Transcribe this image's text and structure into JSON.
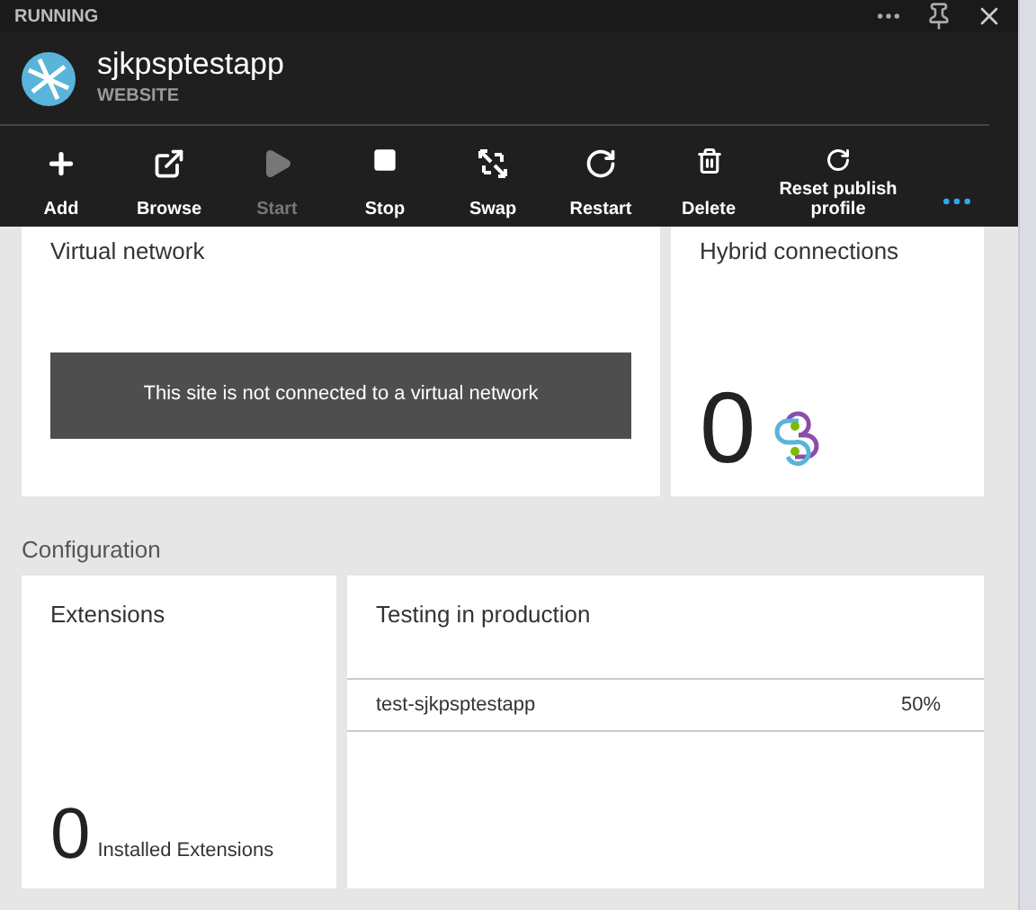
{
  "status": "RUNNING",
  "resource": {
    "name": "sjkpsptestapp",
    "type": "WEBSITE"
  },
  "toolbar": [
    {
      "kind": "add",
      "label": "Add",
      "disabled": false
    },
    {
      "kind": "browse",
      "label": "Browse",
      "disabled": false
    },
    {
      "kind": "start",
      "label": "Start",
      "disabled": true
    },
    {
      "kind": "stop",
      "label": "Stop",
      "disabled": false
    },
    {
      "kind": "swap",
      "label": "Swap",
      "disabled": false
    },
    {
      "kind": "restart",
      "label": "Restart",
      "disabled": false
    },
    {
      "kind": "delete",
      "label": "Delete",
      "disabled": false
    },
    {
      "kind": "reset",
      "label": "Reset publish profile",
      "disabled": false
    }
  ],
  "virtual_network": {
    "title": "Virtual network",
    "message": "This site is not connected to a virtual network"
  },
  "hybrid_connections": {
    "title": "Hybrid connections",
    "count": "0"
  },
  "section": "Configuration",
  "extensions": {
    "title": "Extensions",
    "count": "0",
    "caption": "Installed Extensions"
  },
  "testing": {
    "title": "Testing in production",
    "rows": [
      {
        "name": "test-sjkpsptestapp",
        "percent": "50%"
      }
    ]
  }
}
